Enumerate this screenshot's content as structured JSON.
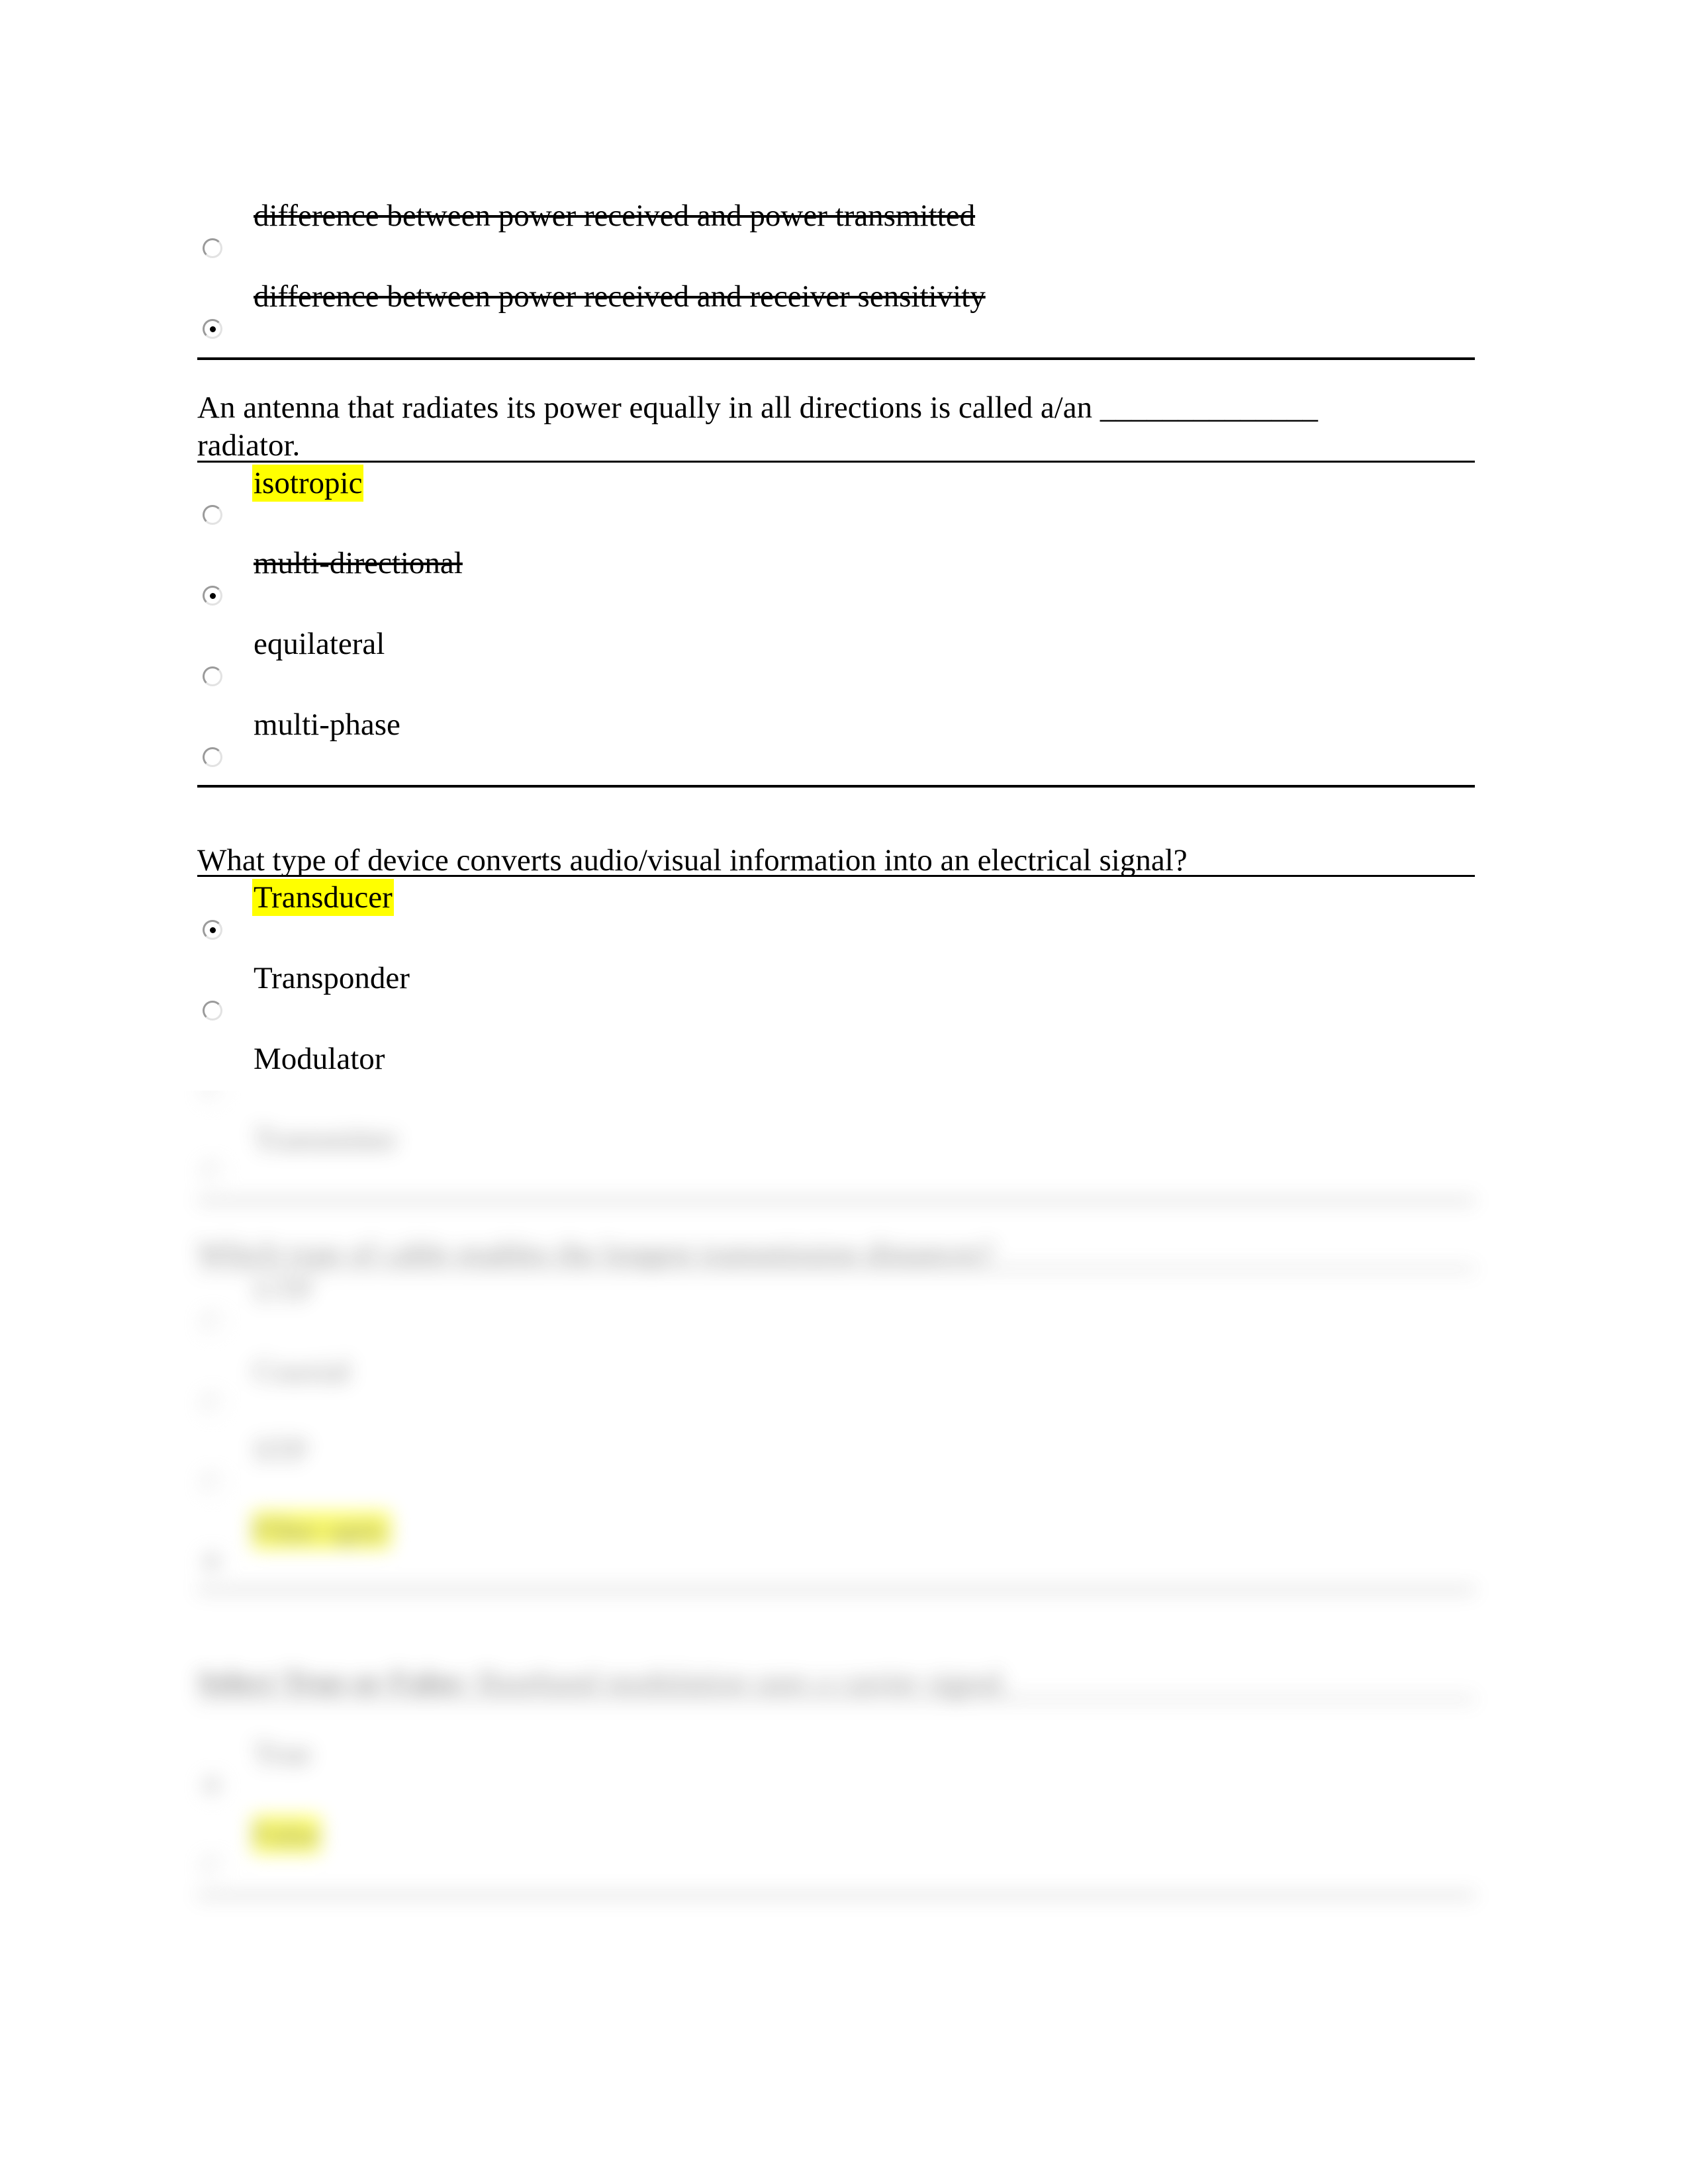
{
  "questions": [
    {
      "text": "",
      "options": [
        {
          "label": "difference between power received and power transmitted",
          "struck": true,
          "highlighted": false,
          "selected": false
        },
        {
          "label": "difference between power received and receiver sensitivity",
          "struck": true,
          "highlighted": false,
          "selected": true
        }
      ]
    },
    {
      "text_line1": "An antenna that radiates its power equally in all directions is called a/an ______________",
      "text_line2": "radiator.",
      "options": [
        {
          "label": "isotropic",
          "struck": false,
          "highlighted": true,
          "selected": false
        },
        {
          "label": "multi-directional",
          "struck": true,
          "highlighted": false,
          "selected": true
        },
        {
          "label": "equilateral",
          "struck": false,
          "highlighted": false,
          "selected": false
        },
        {
          "label": "multi-phase",
          "struck": false,
          "highlighted": false,
          "selected": false
        }
      ]
    },
    {
      "text": "What type of device converts audio/visual information into an electrical signal?",
      "options": [
        {
          "label": "Transducer",
          "struck": false,
          "highlighted": true,
          "selected": true
        },
        {
          "label": "Transponder",
          "struck": false,
          "highlighted": false,
          "selected": false
        },
        {
          "label": "Modulator",
          "struck": false,
          "highlighted": false,
          "selected": false
        },
        {
          "label": "Transmitter",
          "struck": false,
          "highlighted": false,
          "selected": false
        }
      ]
    },
    {
      "text": "Which type of cable enables the longest transmission distances?",
      "options": [
        {
          "label": "UTP",
          "struck": false,
          "highlighted": false,
          "selected": false
        },
        {
          "label": "Coaxial",
          "struck": false,
          "highlighted": false,
          "selected": false
        },
        {
          "label": "STP",
          "struck": false,
          "highlighted": false,
          "selected": false
        },
        {
          "label": "Fiber optic",
          "struck": false,
          "highlighted": true,
          "selected": true
        }
      ]
    },
    {
      "text_bold": "Select True or False:",
      "text": " Baseband modulation uses a carrier signal.",
      "options": [
        {
          "label": "True",
          "struck": false,
          "highlighted": false,
          "selected": true
        },
        {
          "label": "False",
          "struck": false,
          "highlighted": true,
          "selected": false
        }
      ]
    }
  ],
  "colors": {
    "highlight": "#ffff00",
    "text": "#000000",
    "rule": "#000000"
  }
}
